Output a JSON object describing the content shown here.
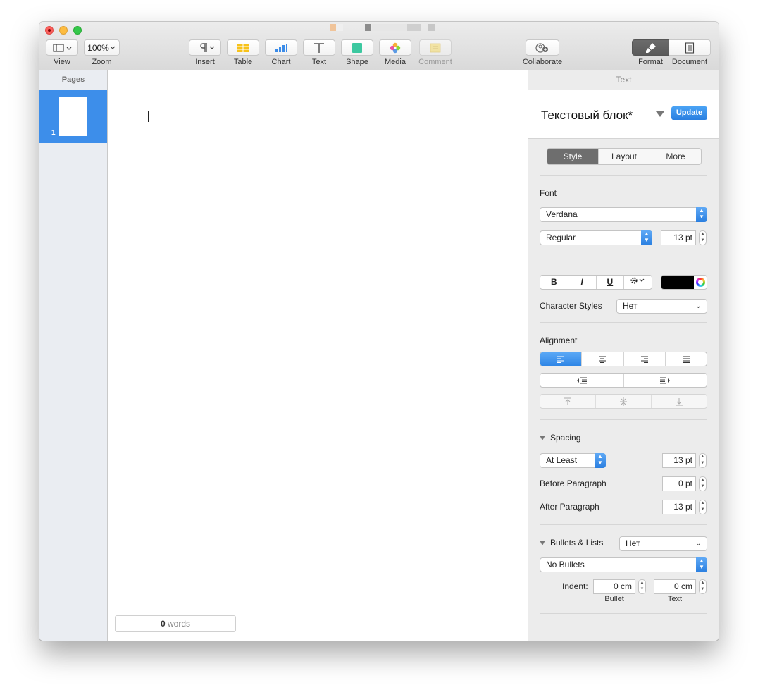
{
  "toolbar": {
    "view_label": "View",
    "zoom_value": "100%",
    "zoom_label": "Zoom",
    "insert_label": "Insert",
    "table_label": "Table",
    "chart_label": "Chart",
    "text_label": "Text",
    "shape_label": "Shape",
    "media_label": "Media",
    "comment_label": "Comment",
    "collaborate_label": "Collaborate",
    "format_label": "Format",
    "document_label": "Document"
  },
  "sidebar": {
    "header": "Pages",
    "pages": [
      {
        "number": "1"
      }
    ]
  },
  "canvas": {
    "word_count_number": "0",
    "word_count_unit": "words"
  },
  "inspector": {
    "header": "Text",
    "paragraph_style": "Текстовый блок*",
    "update_label": "Update",
    "tabs": [
      {
        "label": "Style",
        "active": true
      },
      {
        "label": "Layout",
        "active": false
      },
      {
        "label": "More",
        "active": false
      }
    ],
    "font": {
      "section_label": "Font",
      "family": "Verdana",
      "typeface": "Regular",
      "size": "13 pt",
      "bold": "B",
      "italic": "I",
      "underline": "U",
      "text_color": "#000000",
      "character_styles_label": "Character Styles",
      "character_style": "Нет"
    },
    "alignment": {
      "section_label": "Alignment",
      "selected": "left"
    },
    "spacing": {
      "section_label": "Spacing",
      "line_mode": "At Least",
      "line_value": "13 pt",
      "before_label": "Before Paragraph",
      "before_value": "0 pt",
      "after_label": "After Paragraph",
      "after_value": "13 pt"
    },
    "bullets": {
      "section_label": "Bullets & Lists",
      "list_style": "Нет",
      "bullet_type": "No Bullets",
      "indent_label": "Indent:",
      "bullet_indent": "0 cm",
      "bullet_caption": "Bullet",
      "text_indent": "0 cm",
      "text_caption": "Text"
    }
  },
  "colors": {
    "accent": "#2a7fe0",
    "sidebar_selected": "#3d8eea"
  }
}
